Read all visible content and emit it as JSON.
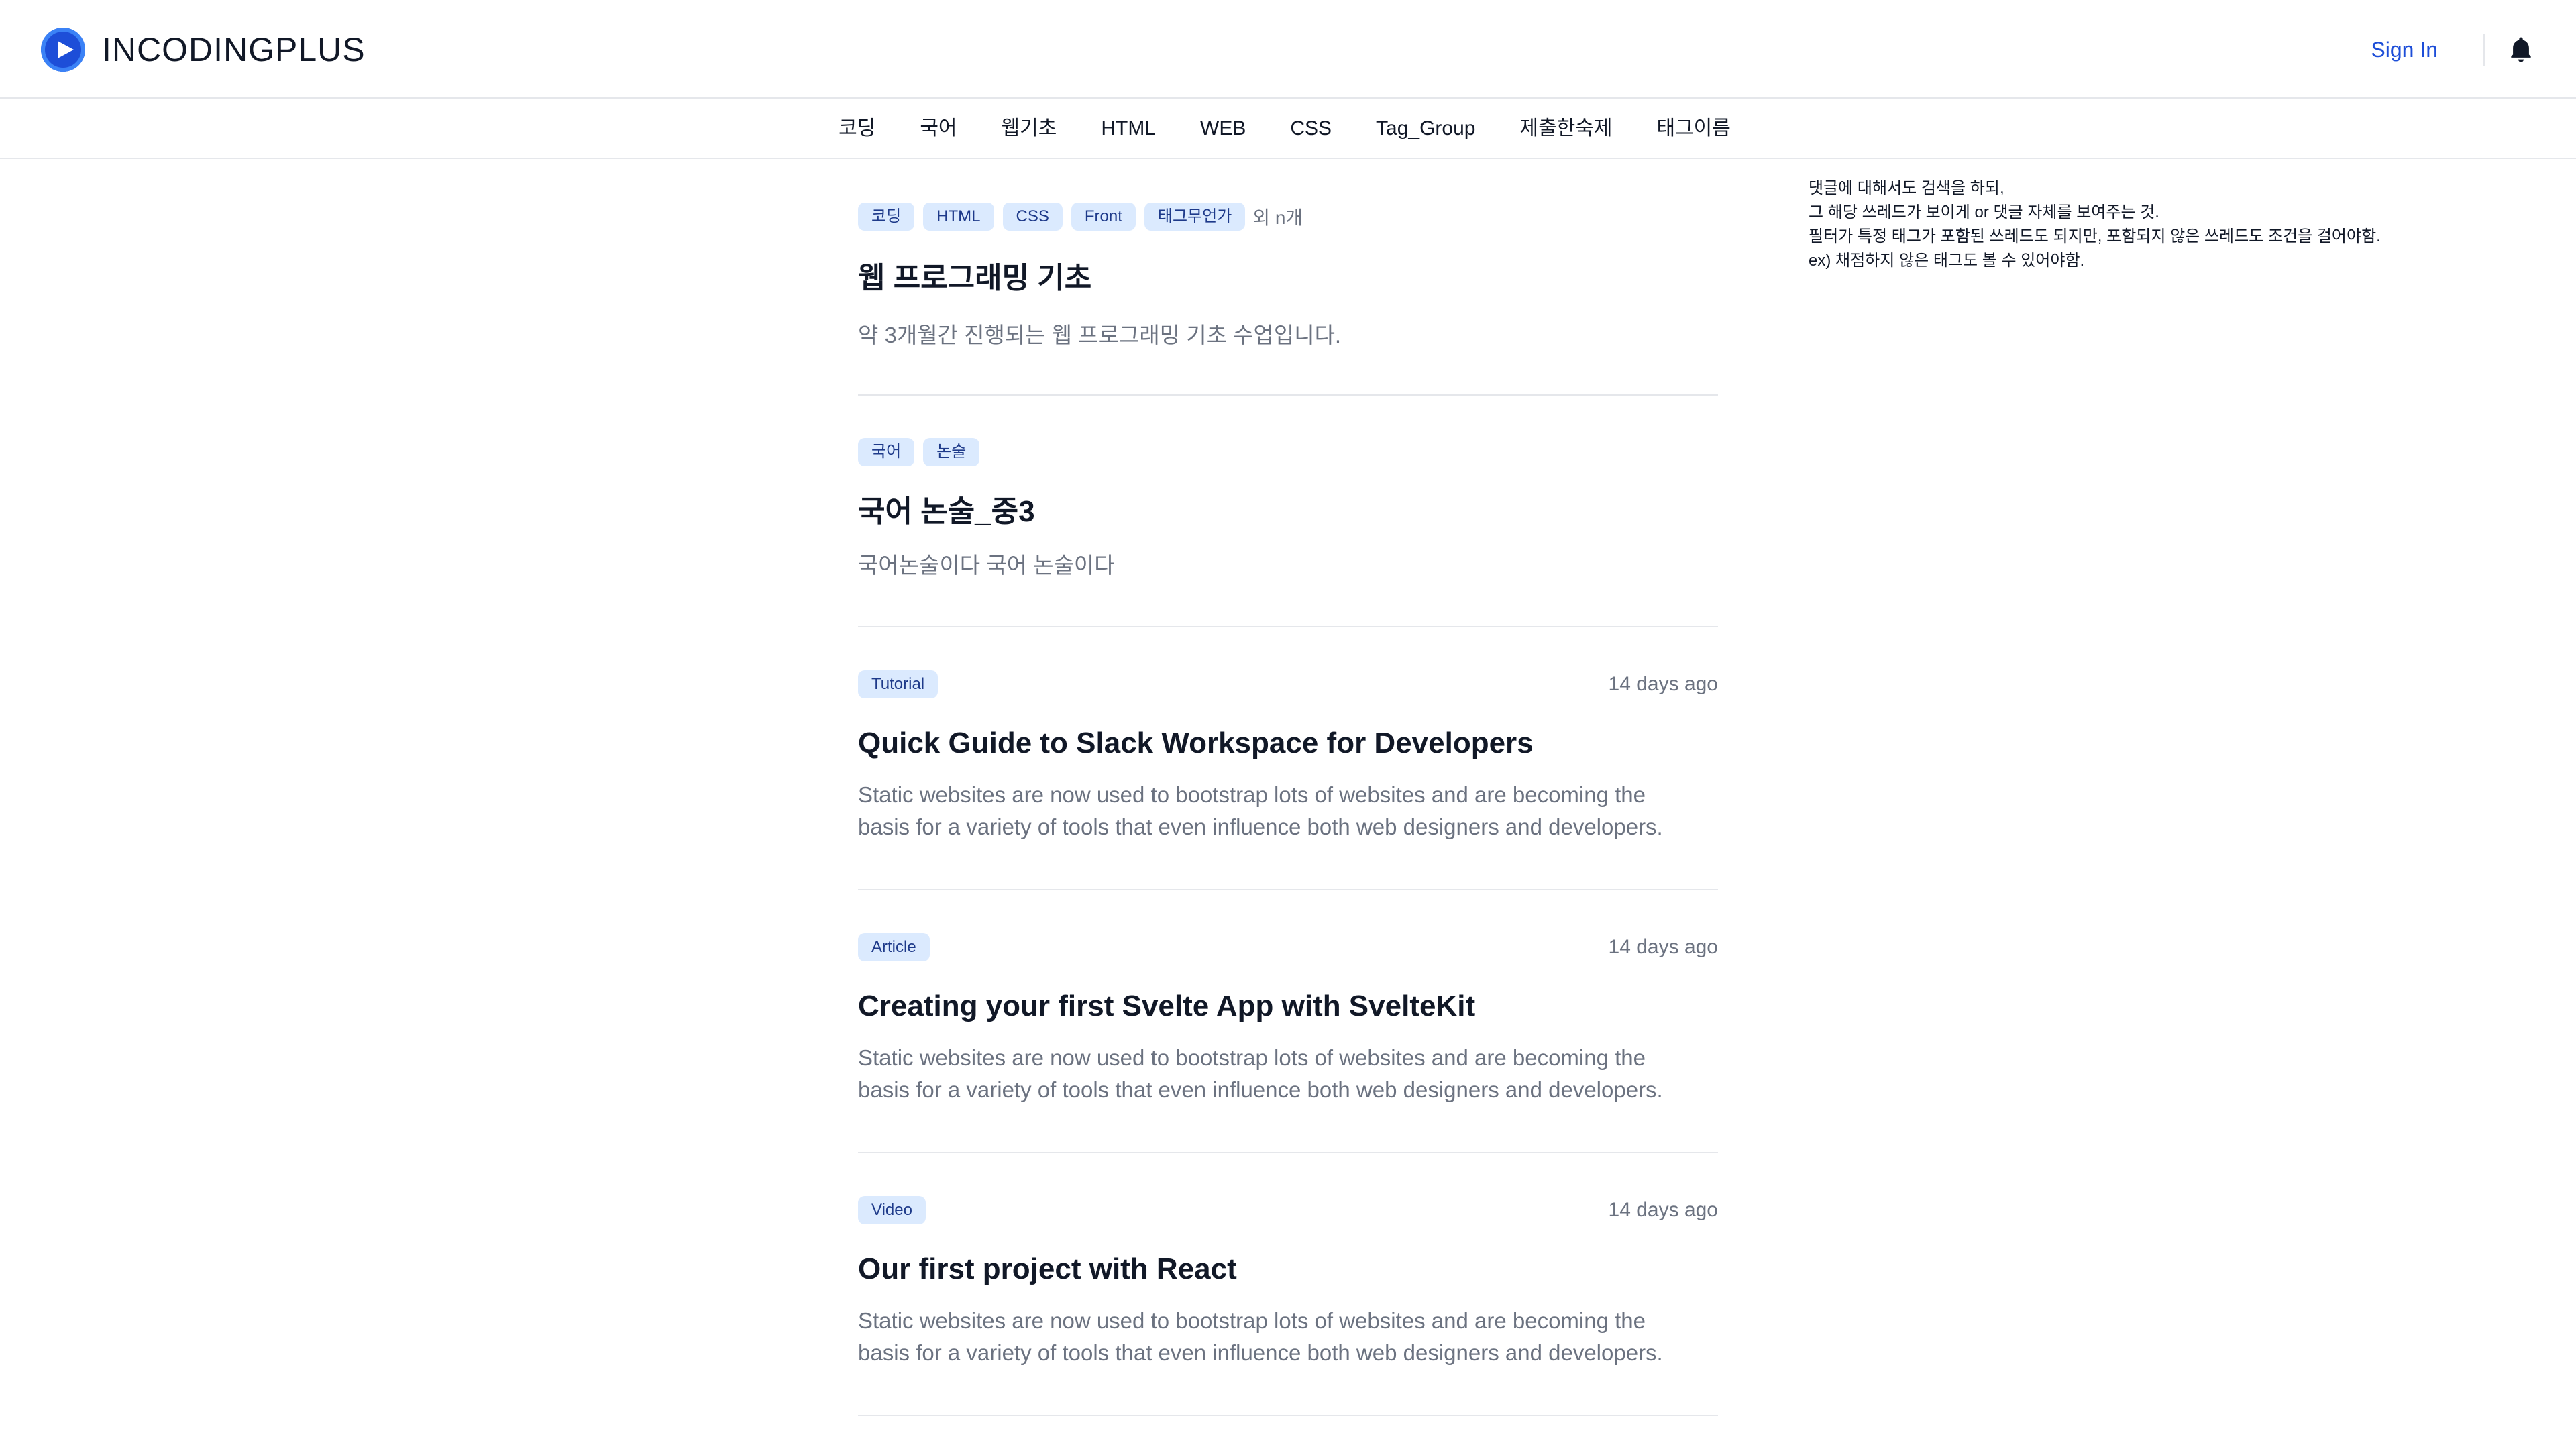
{
  "header": {
    "brand": "INCODINGPLUS",
    "sign_in": "Sign In"
  },
  "nav": {
    "items": [
      "코딩",
      "국어",
      "웹기초",
      "HTML",
      "WEB",
      "CSS",
      "Tag_Group",
      "제출한숙제",
      "태그이름"
    ]
  },
  "posts": [
    {
      "tags": [
        "코딩",
        "HTML",
        "CSS",
        "Front",
        "태그무언가"
      ],
      "tags_more": "외 n개",
      "title": "웹 프로그래밍 기초",
      "description": "약 3개월간 진행되는 웹 프로그래밍 기초 수업입니다.",
      "date": ""
    },
    {
      "tags": [
        "국어",
        "논술"
      ],
      "title": "국어 논술_중3",
      "description": "국어논술이다 국어 논술이다",
      "date": ""
    },
    {
      "tags": [
        "Tutorial"
      ],
      "title": "Quick Guide to Slack Workspace for Developers",
      "description_line1": "Static websites are now used to bootstrap lots of websites and are becoming the",
      "description_line2": "basis for a variety of tools that even influence both web designers and developers.",
      "date": "14 days ago"
    },
    {
      "tags": [
        "Article"
      ],
      "title": "Creating your first Svelte App with SvelteKit",
      "description_line1": "Static websites are now used to bootstrap lots of websites and are becoming the",
      "description_line2": "basis for a variety of tools that even influence both web designers and developers.",
      "date": "14 days ago"
    },
    {
      "tags": [
        "Video"
      ],
      "title": "Our first project with React",
      "description_line1": "Static websites are now used to bootstrap lots of websites and are becoming the",
      "description_line2": "basis for a variety of tools that even influence both web designers and developers.",
      "date": "14 days ago"
    }
  ],
  "side_note": {
    "line1": "댓글에 대해서도 검색을 하되,",
    "line2": "그 해당 쓰레드가 보이게 or 댓글 자체를 보여주는 것.",
    "line3": "필터가 특정 태그가 포함된 쓰레드도 되지만, 포함되지 않은 쓰레드도 조건을 걸어야함.",
    "line4": "ex) 채점하지 않은 태그도 볼 수 있어야함."
  },
  "icons": {
    "logo": "play-circle-icon",
    "notifications": "bell-icon"
  },
  "colors": {
    "accent": "#1d4ed8",
    "tag_bg": "#dbeafe",
    "tag_text": "#1e3a8a",
    "muted_text": "#6b7280",
    "divider": "#e5e7eb"
  }
}
